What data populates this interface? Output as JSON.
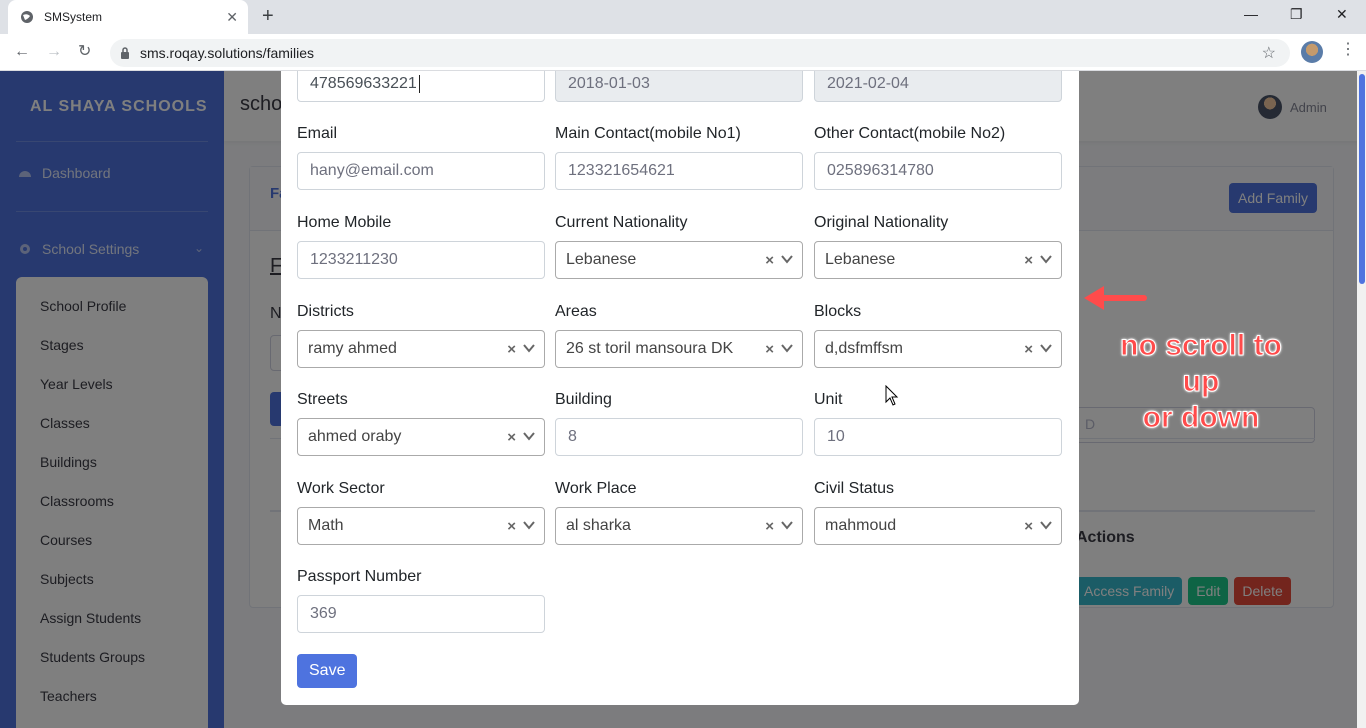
{
  "browser": {
    "tab_title": "SMSystem",
    "url": "sms.roqay.solutions/families",
    "new_tab": "+",
    "close_tab": "✕",
    "minimize": "—",
    "restore": "❐",
    "close_window": "✕",
    "kebab": "⋮"
  },
  "sidebar": {
    "brand": "AL SHAYA SCHOOLS",
    "dashboard": "Dashboard",
    "school_settings": "School Settings",
    "submenu": [
      "School Profile",
      "Stages",
      "Year Levels",
      "Classes",
      "Buildings",
      "Classrooms",
      "Courses",
      "Subjects",
      "Assign Students",
      "Students Groups",
      "Teachers"
    ]
  },
  "topbar": {
    "page_title": "scho",
    "user": "Admin"
  },
  "background": {
    "card_tab": "Fa",
    "section_title": "F",
    "label_fragment": "N",
    "add_family": "Add Family",
    "search_fragment": "D",
    "actions_header": "Actions",
    "row_buttons": {
      "access": "Access Family",
      "edit": "Edit",
      "delete": "Delete"
    }
  },
  "modal": {
    "top_row": [
      "478569633221",
      "2018-01-03",
      "2021-02-04"
    ],
    "fields": {
      "email": {
        "label": "Email",
        "value": "hany@email.com"
      },
      "main_contact": {
        "label": "Main Contact(mobile No1)",
        "value": "123321654621"
      },
      "other_contact": {
        "label": "Other Contact(mobile No2)",
        "value": "025896314780"
      },
      "home_mobile": {
        "label": "Home Mobile",
        "value": "1233211230"
      },
      "current_nationality": {
        "label": "Current Nationality",
        "value": "Lebanese"
      },
      "original_nationality": {
        "label": "Original Nationality",
        "value": "Lebanese"
      },
      "districts": {
        "label": "Districts",
        "value": "ramy ahmed"
      },
      "areas": {
        "label": "Areas",
        "value": "26 st toril mansoura DK"
      },
      "blocks": {
        "label": "Blocks",
        "value": "d,dsfmffsm"
      },
      "streets": {
        "label": "Streets",
        "value": "ahmed oraby"
      },
      "building": {
        "label": "Building",
        "value": "8"
      },
      "unit": {
        "label": "Unit",
        "value": "10"
      },
      "work_sector": {
        "label": "Work Sector",
        "value": "Math"
      },
      "work_place": {
        "label": "Work Place",
        "value": "al sharka"
      },
      "civil_status": {
        "label": "Civil Status",
        "value": "mahmoud"
      },
      "passport": {
        "label": "Passport Number",
        "value": "369"
      }
    },
    "clear_symbol": "×",
    "save_label": "Save"
  },
  "annotation": {
    "line1": "no scroll to up",
    "line2": "or down"
  },
  "colors": {
    "primary": "#4e73df",
    "annotation": "#ff4b4b"
  }
}
